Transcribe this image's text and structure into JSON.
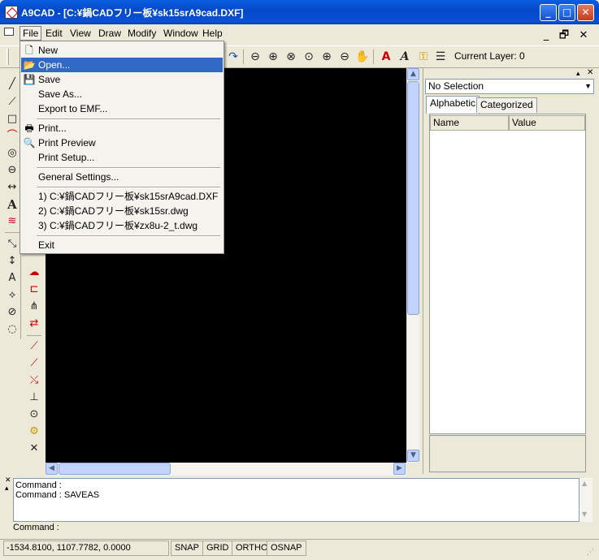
{
  "window": {
    "title": "A9CAD - [C:¥鍋CADフリー板¥sk15srA9cad.DXF]",
    "minimize_glyph": "_",
    "maximize_glyph": "□",
    "close_glyph": "✕"
  },
  "menubar": {
    "items": [
      {
        "label": "File"
      },
      {
        "label": "Edit"
      },
      {
        "label": "View"
      },
      {
        "label": "Draw"
      },
      {
        "label": "Modify"
      },
      {
        "label": "Window"
      },
      {
        "label": "Help"
      }
    ],
    "mdi_min": "_",
    "mdi_restore": "🗗",
    "mdi_close": "✕"
  },
  "toolbar": {
    "current_layer_label": "Current Layer: 0"
  },
  "file_menu": {
    "items": [
      {
        "label": "New",
        "icon": "new-document-icon"
      },
      {
        "label": "Open...",
        "icon": "open-folder-icon",
        "highlighted": true
      },
      {
        "label": "Save",
        "icon": "save-disk-icon"
      },
      {
        "label": "Save As..."
      },
      {
        "label": "Export to EMF..."
      },
      {
        "label": "Print...",
        "icon": "printer-icon"
      },
      {
        "label": "Print Preview",
        "icon": "print-preview-icon"
      },
      {
        "label": "Print Setup..."
      },
      {
        "label": "General Settings..."
      },
      {
        "label": "1)  C:¥鍋CADフリー板¥sk15srA9cad.DXF"
      },
      {
        "label": "2)  C:¥鍋CADフリー板¥sk15sr.dwg"
      },
      {
        "label": "3)  C:¥鍋CADフリー板¥zx8u-2_t.dwg"
      },
      {
        "label": "Exit"
      }
    ]
  },
  "properties": {
    "selection": "No Selection",
    "tabs": [
      {
        "label": "Alphabetic",
        "selected": true
      },
      {
        "label": "Categorized",
        "selected": false
      }
    ],
    "columns": [
      "Name",
      "Value"
    ]
  },
  "command": {
    "history": [
      "Command :",
      "Command : SAVEAS"
    ],
    "prompt": "Command :"
  },
  "statusbar": {
    "coordinates": "-1534.8100, 1107.7782, 0.0000",
    "toggles": [
      "SNAP",
      "GRID",
      "ORTHO",
      "OSNAP"
    ]
  },
  "colors": {
    "titlebar": "#0a5fe0",
    "menu_highlight": "#316ac5",
    "canvas": "#000000"
  }
}
